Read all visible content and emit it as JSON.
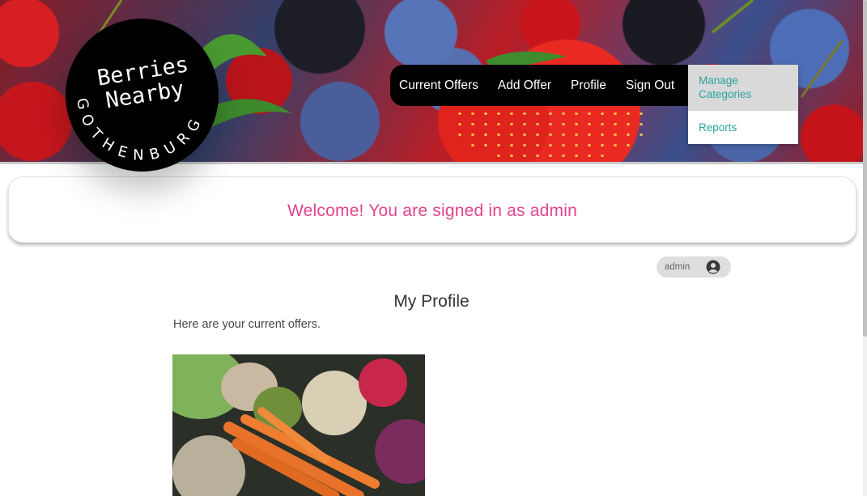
{
  "brand": {
    "title_line1": "Berries",
    "title_line2": "Nearby",
    "ring_text": "GOTHENBURG"
  },
  "nav": {
    "items": [
      "Current Offers",
      "Add Offer",
      "Profile",
      "Sign Out"
    ],
    "dropdown": [
      "Manage Categories",
      "Reports"
    ]
  },
  "welcome": {
    "message": "Welcome! You are signed in as admin",
    "color": "#e0458c"
  },
  "user": {
    "name": "admin",
    "icon": "user-circle-icon"
  },
  "profile": {
    "title": "My Profile",
    "subtitle": "Here are your current offers."
  },
  "colors": {
    "accent_teal": "#2aa3a0",
    "nav_bg": "#000000"
  }
}
